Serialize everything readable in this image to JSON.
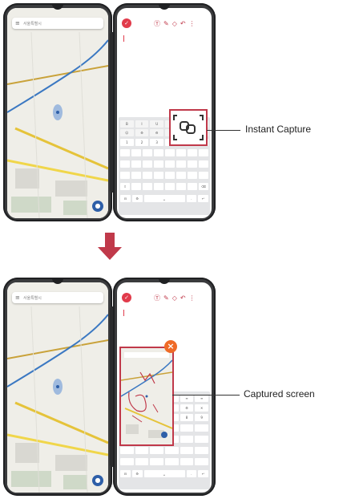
{
  "top_scene": {
    "left_screen": {
      "search_placeholder": "서울특별시"
    },
    "right_screen": {
      "toolbar_icons": [
        "pen-icon",
        "text-icon",
        "brush-icon",
        "eraser-icon",
        "undo-icon",
        "more-icon"
      ]
    },
    "callout": {
      "label": "Instant Capture"
    }
  },
  "transition": {
    "arrow_icon": "down-arrow-icon",
    "color": "#c0394a"
  },
  "bottom_scene": {
    "left_screen": {
      "search_placeholder": "서울특별시"
    },
    "right_screen": {
      "toolbar_icons": [
        "pen-icon",
        "text-icon",
        "brush-icon",
        "eraser-icon",
        "undo-icon",
        "more-icon"
      ]
    },
    "callout": {
      "label": "Captured screen"
    }
  },
  "colors": {
    "accent": "#c0394a",
    "close": "#ef6a26",
    "device": "#3a3b3d",
    "map": "#efeee8"
  }
}
